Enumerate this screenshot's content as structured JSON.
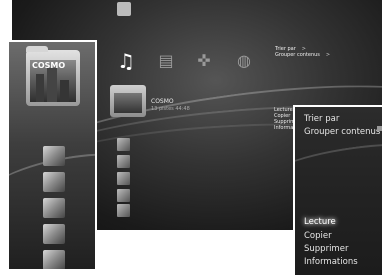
{
  "xmb": {
    "categories": [
      {
        "name": "music-icon",
        "glyph": "♫",
        "selected": true
      },
      {
        "name": "video-icon",
        "glyph": "▤",
        "selected": false
      },
      {
        "name": "game-icon",
        "glyph": "✜",
        "selected": false
      },
      {
        "name": "network-icon",
        "glyph": "◍",
        "selected": false
      }
    ],
    "folder": {
      "title": "COSMO",
      "subtitle": "13 pistes   44:48"
    },
    "options_menu": [
      {
        "label": "Trier par",
        "arrow": ">"
      },
      {
        "label": "Grouper contenus",
        "arrow": ">"
      }
    ],
    "context_menu": [
      "Lecture",
      "Copier",
      "Supprimer",
      "Informations"
    ]
  },
  "left_panel": {
    "folder_label": "COSMO",
    "thumbnail_icon": "album-thumbnail-icon"
  },
  "right_panel": {
    "options": [
      "Trier par",
      "Grouper contenus"
    ],
    "actions": [
      {
        "label": "Lecture",
        "selected": true
      },
      {
        "label": "Copier",
        "selected": false
      },
      {
        "label": "Supprimer",
        "selected": false
      },
      {
        "label": "Informations",
        "selected": false
      }
    ]
  }
}
